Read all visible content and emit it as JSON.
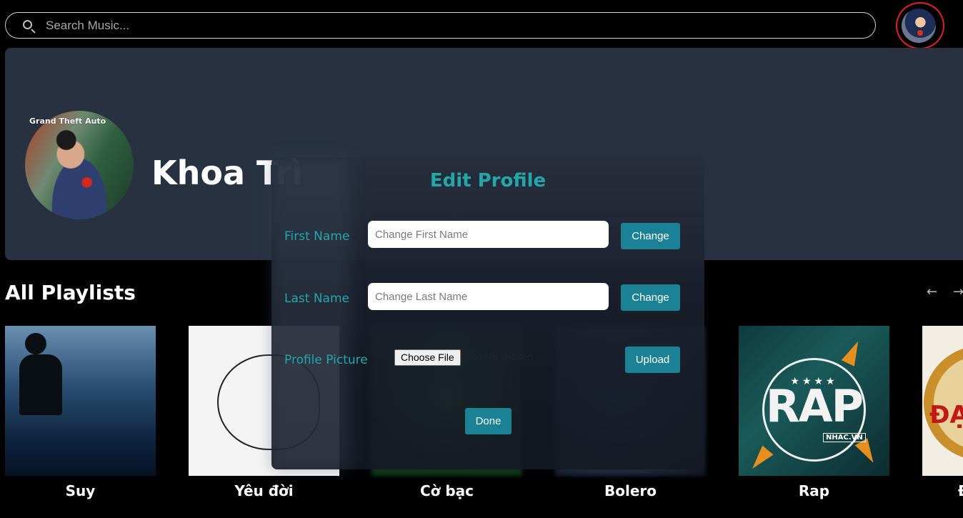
{
  "search": {
    "placeholder": "Search Music..."
  },
  "profile": {
    "name": "Khoa Trì",
    "photo_caption": "Grand Theft Auto"
  },
  "playlists": {
    "title": "All Playlists",
    "prev_icon": "←",
    "next_icon": "→",
    "items": [
      {
        "title": "Suy"
      },
      {
        "title": "Yêu đời"
      },
      {
        "title": "Cờ bạc"
      },
      {
        "title": "Bolero"
      },
      {
        "title": "Rap",
        "art_text": "RAP",
        "art_stars": "★★★★",
        "art_tag": "NHAC.VN"
      },
      {
        "title": "Đ",
        "art_text": "ĐẠ"
      }
    ]
  },
  "modal": {
    "title": "Edit Profile",
    "first_name_label": "First Name",
    "first_name_placeholder": "Change First Name",
    "last_name_label": "Last Name",
    "last_name_placeholder": "Change Last Name",
    "change_label": "Change",
    "profile_picture_label": "Profile Picture",
    "choose_file_label": "Choose File",
    "file_status": "No file chosen",
    "upload_label": "Upload",
    "done_label": "Done"
  },
  "colors": {
    "accent": "#25a6a9",
    "button": "#1b8296",
    "banner": "#273140",
    "highlight_ring": "#e0202a"
  }
}
